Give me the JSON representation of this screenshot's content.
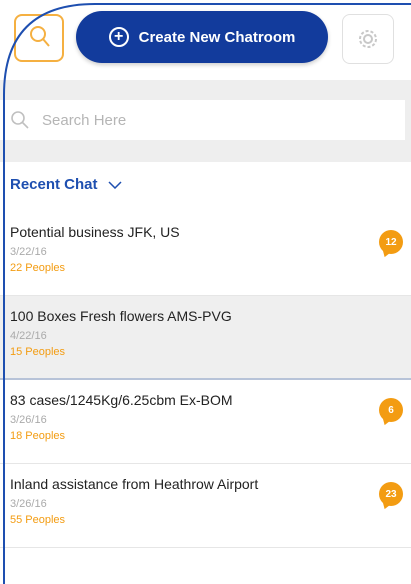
{
  "header": {
    "create_label": "Create New Chatroom"
  },
  "search": {
    "placeholder": "Search Here"
  },
  "recent": {
    "title": "Recent Chat"
  },
  "chats": [
    {
      "title": "Potential business JFK, US",
      "date": "3/22/16",
      "people": "22 Peoples",
      "badge": "12"
    },
    {
      "title": "100 Boxes Fresh flowers AMS-PVG",
      "date": "4/22/16",
      "people": "15 Peoples",
      "badge": ""
    },
    {
      "title": "83 cases/1245Kg/6.25cbm Ex-BOM",
      "date": "3/26/16",
      "people": "18 Peoples",
      "badge": "6"
    },
    {
      "title": "Inland assistance from Heathrow Airport",
      "date": "3/26/16",
      "people": "55 Peoples",
      "badge": "23"
    }
  ],
  "colors": {
    "brand": "#123b9c",
    "accent": "#f39c12",
    "link": "#1e4fb0"
  }
}
